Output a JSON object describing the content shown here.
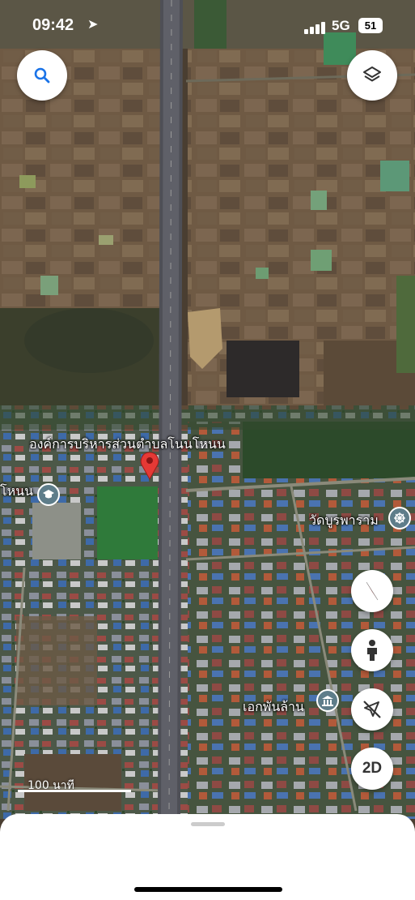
{
  "status_bar": {
    "time": "09:42",
    "location_glyph": "➤",
    "network": "5G",
    "battery": "51"
  },
  "map": {
    "type": "satellite",
    "labels": {
      "admin_office": "องค์การบริหารส่วนตำบลโนนโหนน",
      "school": "โหนน",
      "temple": "วัดบูรพาราม",
      "place": "เอกพันล้าน"
    },
    "scale_label": "100 นาที",
    "pin_color": "#e53935",
    "icons": {
      "search": "search-icon",
      "layers": "layers-icon",
      "compass": "compass-icon",
      "street_view": "street-view-icon",
      "navigation_off": "navigation-off-icon",
      "school": "school-icon",
      "temple": "temple-icon",
      "museum": "museum-icon"
    }
  },
  "controls": {
    "view_toggle": "2D"
  }
}
